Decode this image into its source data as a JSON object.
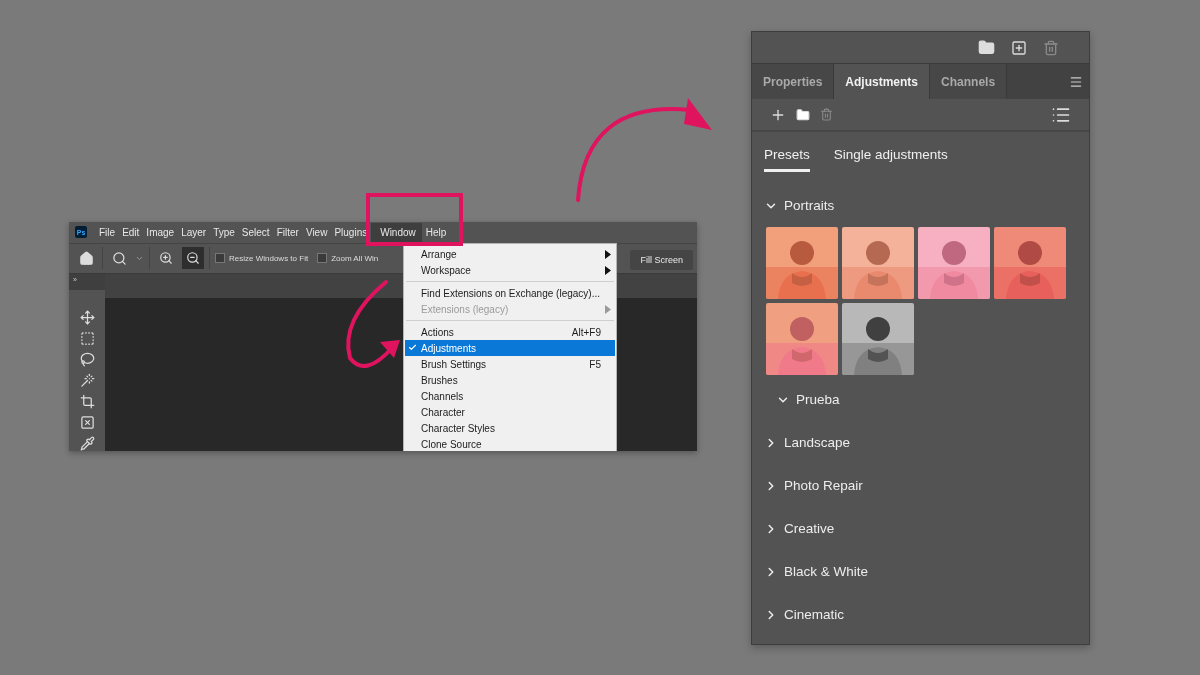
{
  "photoshop_window": {
    "logo": "Ps",
    "menu_bar": [
      {
        "label": "File",
        "selected": false
      },
      {
        "label": "Edit",
        "selected": false
      },
      {
        "label": "Image",
        "selected": false
      },
      {
        "label": "Layer",
        "selected": false
      },
      {
        "label": "Type",
        "selected": false
      },
      {
        "label": "Select",
        "selected": false
      },
      {
        "label": "Filter",
        "selected": false
      },
      {
        "label": "View",
        "selected": false
      },
      {
        "label": "Plugins",
        "selected": false
      },
      {
        "label": "Window",
        "selected": true
      },
      {
        "label": "Help",
        "selected": false
      }
    ],
    "options_bar": {
      "checkboxes": [
        {
          "label": "Resize Windows to Fit",
          "checked": false
        },
        {
          "label": "Zoom All Win",
          "checked": false
        }
      ],
      "button": "Fill Screen"
    },
    "tools_collapse": "»",
    "window_menu": {
      "groups": [
        [
          {
            "label": "Arrange",
            "submenu": true,
            "disabled": false,
            "checked": false,
            "selected": false
          },
          {
            "label": "Workspace",
            "submenu": true,
            "disabled": false,
            "checked": false,
            "selected": false
          }
        ],
        [
          {
            "label": "Find Extensions on Exchange (legacy)...",
            "submenu": false,
            "disabled": false,
            "checked": false,
            "selected": false
          },
          {
            "label": "Extensions (legacy)",
            "submenu": true,
            "disabled": true,
            "checked": false,
            "selected": false
          }
        ],
        [
          {
            "label": "Actions",
            "shortcut": "Alt+F9",
            "submenu": false,
            "disabled": false,
            "checked": false,
            "selected": false
          },
          {
            "label": "Adjustments",
            "submenu": false,
            "disabled": false,
            "checked": true,
            "selected": true
          },
          {
            "label": "Brush Settings",
            "shortcut": "F5",
            "submenu": false,
            "disabled": false,
            "checked": false,
            "selected": false
          },
          {
            "label": "Brushes",
            "submenu": false,
            "disabled": false,
            "checked": false,
            "selected": false
          },
          {
            "label": "Channels",
            "submenu": false,
            "disabled": false,
            "checked": false,
            "selected": false
          },
          {
            "label": "Character",
            "submenu": false,
            "disabled": false,
            "checked": false,
            "selected": false
          },
          {
            "label": "Character Styles",
            "submenu": false,
            "disabled": false,
            "checked": false,
            "selected": false
          },
          {
            "label": "Clone Source",
            "submenu": false,
            "disabled": false,
            "checked": false,
            "selected": false
          }
        ]
      ]
    }
  },
  "adjustments_panel": {
    "tabs": [
      {
        "label": "Properties",
        "selected": false
      },
      {
        "label": "Adjustments",
        "selected": true
      },
      {
        "label": "Channels",
        "selected": false
      }
    ],
    "subtabs": [
      {
        "label": "Presets",
        "selected": true
      },
      {
        "label": "Single adjustments",
        "selected": false
      }
    ],
    "sections": [
      {
        "label": "Portraits",
        "expanded": true,
        "thumbnails": [
          {
            "kind": "picture"
          },
          {
            "kind": "picture"
          },
          {
            "kind": "picture"
          },
          {
            "kind": "picture"
          },
          {
            "kind": "picture"
          },
          {
            "kind": "picture"
          }
        ],
        "children": [
          {
            "label": "Prueba",
            "expanded": true
          }
        ]
      },
      {
        "label": "Landscape",
        "expanded": false
      },
      {
        "label": "Photo Repair",
        "expanded": false
      },
      {
        "label": "Creative",
        "expanded": false
      },
      {
        "label": "Black & White",
        "expanded": false
      },
      {
        "label": "Cinematic",
        "expanded": false
      }
    ]
  }
}
